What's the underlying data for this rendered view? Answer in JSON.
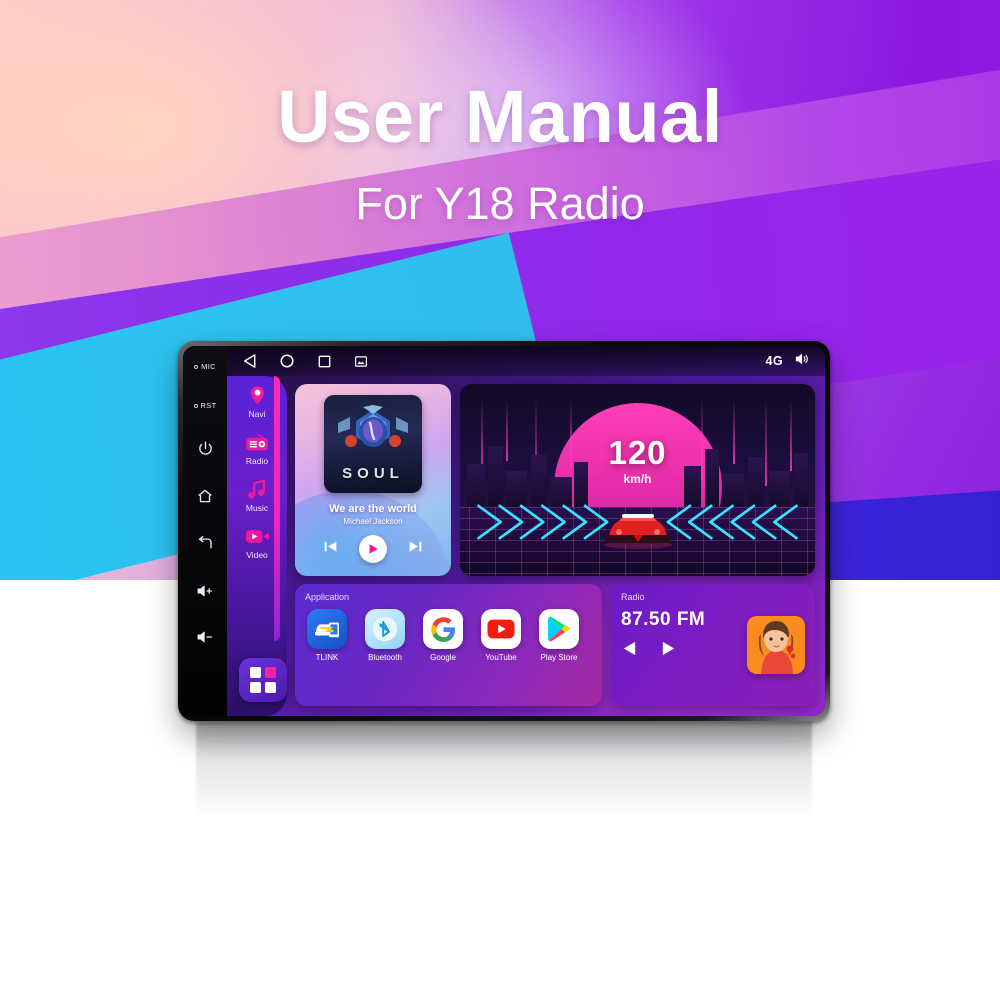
{
  "header": {
    "title": "User Manual",
    "subtitle": "For Y18 Radio"
  },
  "device": {
    "bezel_buttons": [
      {
        "name": "mic",
        "label": "MIC",
        "type": "dot-label"
      },
      {
        "name": "reset",
        "label": "RST",
        "type": "dot-label"
      },
      {
        "name": "power",
        "label": "",
        "type": "icon"
      },
      {
        "name": "home",
        "label": "",
        "type": "icon"
      },
      {
        "name": "back",
        "label": "",
        "type": "icon"
      },
      {
        "name": "volume-up",
        "label": "",
        "type": "icon"
      },
      {
        "name": "volume-down",
        "label": "",
        "type": "icon"
      }
    ]
  },
  "statusbar": {
    "nav": [
      {
        "icon": "back-triangle-icon",
        "label": "Back"
      },
      {
        "icon": "home-circle-icon",
        "label": "Home"
      },
      {
        "icon": "recents-square-icon",
        "label": "Recents"
      },
      {
        "icon": "screenshot-icon",
        "label": "Screenshot"
      }
    ],
    "network": "4G",
    "volume_icon": "volume-icon"
  },
  "sidebar": {
    "items": [
      {
        "label": "Navi",
        "icon": "location-pin-icon"
      },
      {
        "label": "Radio",
        "icon": "radio-icon"
      },
      {
        "label": "Music",
        "icon": "music-note-icon"
      },
      {
        "label": "Video",
        "icon": "video-camera-icon"
      }
    ],
    "grid_button": "all-apps-icon"
  },
  "music": {
    "album_word": "SOUL",
    "song": "We are the world",
    "artist": "Michael Jackson",
    "controls": [
      {
        "name": "previous-track",
        "icon": "skip-back-icon"
      },
      {
        "name": "play",
        "icon": "play-icon"
      },
      {
        "name": "next-track",
        "icon": "skip-forward-icon"
      }
    ]
  },
  "speed": {
    "value": "120",
    "unit": "km/h"
  },
  "application": {
    "title": "Application",
    "apps": [
      {
        "label": "TLINK",
        "icon": "tlink-icon"
      },
      {
        "label": "Bluetooth",
        "icon": "bluetooth-icon"
      },
      {
        "label": "Google",
        "icon": "google-icon"
      },
      {
        "label": "YouTube",
        "icon": "youtube-icon"
      },
      {
        "label": "Play Store",
        "icon": "play-store-icon"
      }
    ]
  },
  "radio": {
    "title": "Radio",
    "frequency": "87.50  FM",
    "prev_icon": "prev-station-icon",
    "next_icon": "next-station-icon"
  },
  "colors": {
    "accent_magenta": "#ff2db0",
    "accent_purple": "#8b28d8",
    "screen_bg": "#4b1a9c",
    "cyan_band": "#2ec2f0"
  }
}
